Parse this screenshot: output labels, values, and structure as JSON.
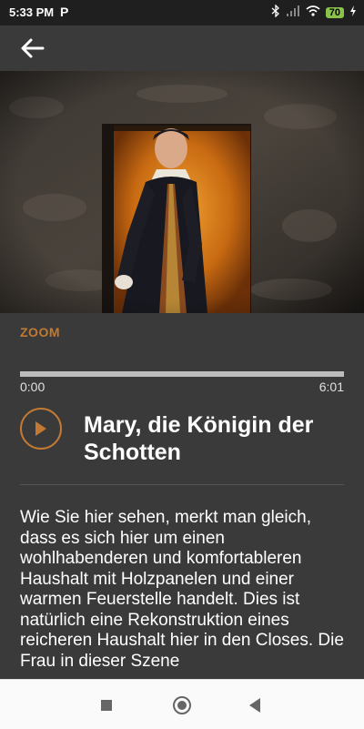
{
  "status_bar": {
    "time": "5:33 PM",
    "app_icon": "P",
    "battery": "70"
  },
  "app_bar": {
    "back_icon": "arrow-left-icon"
  },
  "hero": {
    "image_subject": "woman in historical dress in a stone doorway"
  },
  "player": {
    "section_label": "ZOOM",
    "current_time": "0:00",
    "duration": "6:01",
    "progress": 0.0,
    "play_icon": "play-icon",
    "title": "Mary, die Königin der Schotten"
  },
  "description": "Wie Sie hier sehen, merkt man gleich, dass es sich hier um einen wohlhabenderen und komfortableren Haushalt mit Holzpanelen und einer warmen Feuerstelle handelt. Dies ist natürlich eine Rekonstruktion eines reicheren Haushalt hier in den Closes. Die Frau in dieser Szene",
  "colors": {
    "accent": "#c27a33",
    "background": "#3a3a3a",
    "status_bar": "#1f1f1f"
  }
}
